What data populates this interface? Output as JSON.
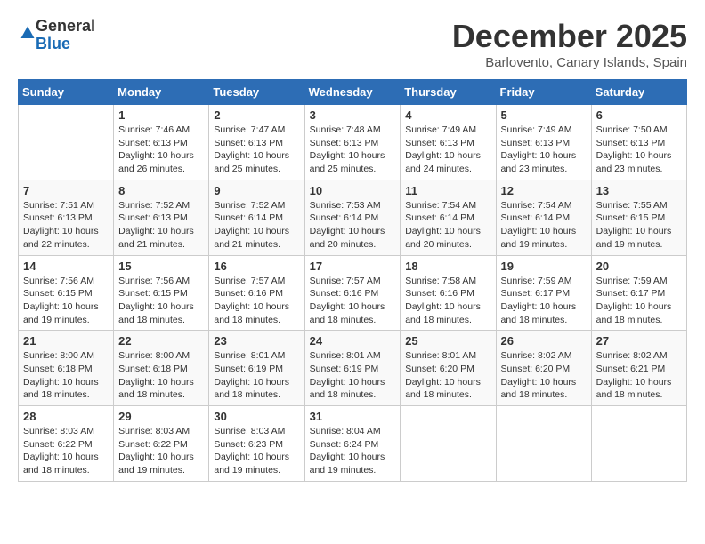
{
  "logo": {
    "general": "General",
    "blue": "Blue"
  },
  "title": "December 2025",
  "subtitle": "Barlovento, Canary Islands, Spain",
  "days_of_week": [
    "Sunday",
    "Monday",
    "Tuesday",
    "Wednesday",
    "Thursday",
    "Friday",
    "Saturday"
  ],
  "weeks": [
    [
      {
        "day": "",
        "sunrise": "",
        "sunset": "",
        "daylight": ""
      },
      {
        "day": "1",
        "sunrise": "Sunrise: 7:46 AM",
        "sunset": "Sunset: 6:13 PM",
        "daylight": "Daylight: 10 hours and 26 minutes."
      },
      {
        "day": "2",
        "sunrise": "Sunrise: 7:47 AM",
        "sunset": "Sunset: 6:13 PM",
        "daylight": "Daylight: 10 hours and 25 minutes."
      },
      {
        "day": "3",
        "sunrise": "Sunrise: 7:48 AM",
        "sunset": "Sunset: 6:13 PM",
        "daylight": "Daylight: 10 hours and 25 minutes."
      },
      {
        "day": "4",
        "sunrise": "Sunrise: 7:49 AM",
        "sunset": "Sunset: 6:13 PM",
        "daylight": "Daylight: 10 hours and 24 minutes."
      },
      {
        "day": "5",
        "sunrise": "Sunrise: 7:49 AM",
        "sunset": "Sunset: 6:13 PM",
        "daylight": "Daylight: 10 hours and 23 minutes."
      },
      {
        "day": "6",
        "sunrise": "Sunrise: 7:50 AM",
        "sunset": "Sunset: 6:13 PM",
        "daylight": "Daylight: 10 hours and 23 minutes."
      }
    ],
    [
      {
        "day": "7",
        "sunrise": "Sunrise: 7:51 AM",
        "sunset": "Sunset: 6:13 PM",
        "daylight": "Daylight: 10 hours and 22 minutes."
      },
      {
        "day": "8",
        "sunrise": "Sunrise: 7:52 AM",
        "sunset": "Sunset: 6:13 PM",
        "daylight": "Daylight: 10 hours and 21 minutes."
      },
      {
        "day": "9",
        "sunrise": "Sunrise: 7:52 AM",
        "sunset": "Sunset: 6:14 PM",
        "daylight": "Daylight: 10 hours and 21 minutes."
      },
      {
        "day": "10",
        "sunrise": "Sunrise: 7:53 AM",
        "sunset": "Sunset: 6:14 PM",
        "daylight": "Daylight: 10 hours and 20 minutes."
      },
      {
        "day": "11",
        "sunrise": "Sunrise: 7:54 AM",
        "sunset": "Sunset: 6:14 PM",
        "daylight": "Daylight: 10 hours and 20 minutes."
      },
      {
        "day": "12",
        "sunrise": "Sunrise: 7:54 AM",
        "sunset": "Sunset: 6:14 PM",
        "daylight": "Daylight: 10 hours and 19 minutes."
      },
      {
        "day": "13",
        "sunrise": "Sunrise: 7:55 AM",
        "sunset": "Sunset: 6:15 PM",
        "daylight": "Daylight: 10 hours and 19 minutes."
      }
    ],
    [
      {
        "day": "14",
        "sunrise": "Sunrise: 7:56 AM",
        "sunset": "Sunset: 6:15 PM",
        "daylight": "Daylight: 10 hours and 19 minutes."
      },
      {
        "day": "15",
        "sunrise": "Sunrise: 7:56 AM",
        "sunset": "Sunset: 6:15 PM",
        "daylight": "Daylight: 10 hours and 18 minutes."
      },
      {
        "day": "16",
        "sunrise": "Sunrise: 7:57 AM",
        "sunset": "Sunset: 6:16 PM",
        "daylight": "Daylight: 10 hours and 18 minutes."
      },
      {
        "day": "17",
        "sunrise": "Sunrise: 7:57 AM",
        "sunset": "Sunset: 6:16 PM",
        "daylight": "Daylight: 10 hours and 18 minutes."
      },
      {
        "day": "18",
        "sunrise": "Sunrise: 7:58 AM",
        "sunset": "Sunset: 6:16 PM",
        "daylight": "Daylight: 10 hours and 18 minutes."
      },
      {
        "day": "19",
        "sunrise": "Sunrise: 7:59 AM",
        "sunset": "Sunset: 6:17 PM",
        "daylight": "Daylight: 10 hours and 18 minutes."
      },
      {
        "day": "20",
        "sunrise": "Sunrise: 7:59 AM",
        "sunset": "Sunset: 6:17 PM",
        "daylight": "Daylight: 10 hours and 18 minutes."
      }
    ],
    [
      {
        "day": "21",
        "sunrise": "Sunrise: 8:00 AM",
        "sunset": "Sunset: 6:18 PM",
        "daylight": "Daylight: 10 hours and 18 minutes."
      },
      {
        "day": "22",
        "sunrise": "Sunrise: 8:00 AM",
        "sunset": "Sunset: 6:18 PM",
        "daylight": "Daylight: 10 hours and 18 minutes."
      },
      {
        "day": "23",
        "sunrise": "Sunrise: 8:01 AM",
        "sunset": "Sunset: 6:19 PM",
        "daylight": "Daylight: 10 hours and 18 minutes."
      },
      {
        "day": "24",
        "sunrise": "Sunrise: 8:01 AM",
        "sunset": "Sunset: 6:19 PM",
        "daylight": "Daylight: 10 hours and 18 minutes."
      },
      {
        "day": "25",
        "sunrise": "Sunrise: 8:01 AM",
        "sunset": "Sunset: 6:20 PM",
        "daylight": "Daylight: 10 hours and 18 minutes."
      },
      {
        "day": "26",
        "sunrise": "Sunrise: 8:02 AM",
        "sunset": "Sunset: 6:20 PM",
        "daylight": "Daylight: 10 hours and 18 minutes."
      },
      {
        "day": "27",
        "sunrise": "Sunrise: 8:02 AM",
        "sunset": "Sunset: 6:21 PM",
        "daylight": "Daylight: 10 hours and 18 minutes."
      }
    ],
    [
      {
        "day": "28",
        "sunrise": "Sunrise: 8:03 AM",
        "sunset": "Sunset: 6:22 PM",
        "daylight": "Daylight: 10 hours and 18 minutes."
      },
      {
        "day": "29",
        "sunrise": "Sunrise: 8:03 AM",
        "sunset": "Sunset: 6:22 PM",
        "daylight": "Daylight: 10 hours and 19 minutes."
      },
      {
        "day": "30",
        "sunrise": "Sunrise: 8:03 AM",
        "sunset": "Sunset: 6:23 PM",
        "daylight": "Daylight: 10 hours and 19 minutes."
      },
      {
        "day": "31",
        "sunrise": "Sunrise: 8:04 AM",
        "sunset": "Sunset: 6:24 PM",
        "daylight": "Daylight: 10 hours and 19 minutes."
      },
      {
        "day": "",
        "sunrise": "",
        "sunset": "",
        "daylight": ""
      },
      {
        "day": "",
        "sunrise": "",
        "sunset": "",
        "daylight": ""
      },
      {
        "day": "",
        "sunrise": "",
        "sunset": "",
        "daylight": ""
      }
    ]
  ]
}
